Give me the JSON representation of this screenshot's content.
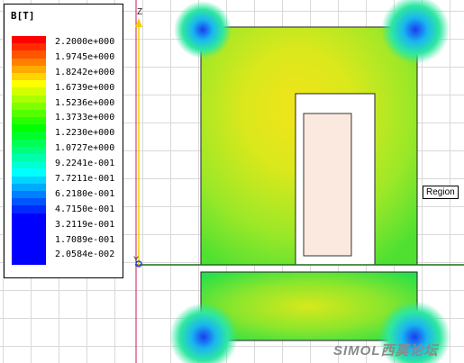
{
  "legend": {
    "title": "B[T]",
    "labels": [
      "2.2000e+000",
      "1.9745e+000",
      "1.8242e+000",
      "1.6739e+000",
      "1.5236e+000",
      "1.3733e+000",
      "1.2230e+000",
      "1.0727e+000",
      "9.2241e-001",
      "7.7211e-001",
      "6.2180e-001",
      "4.7150e-001",
      "3.2119e-001",
      "1.7089e-001",
      "2.0584e-002"
    ],
    "colors": [
      "#ff0000",
      "#ff2a00",
      "#ff5500",
      "#ff8000",
      "#ffaa00",
      "#ffd400",
      "#ffff00",
      "#d4ff00",
      "#aaff00",
      "#80ff00",
      "#55ff00",
      "#2aff00",
      "#00ff00",
      "#00ff2a",
      "#00ff55",
      "#00ff80",
      "#00ffaa",
      "#00ffd4",
      "#00ffff",
      "#00d4ff",
      "#00aaff",
      "#0080ff",
      "#0055ff",
      "#002aff",
      "#0000ff",
      "#0000ff",
      "#0000ff",
      "#0000ff",
      "#0000ff",
      "#0000ff",
      "#0000ff"
    ]
  },
  "axes": {
    "z_label": "Z",
    "y_label": "Y"
  },
  "tooltip": {
    "text": "Region"
  },
  "watermark": {
    "text": "SIMOL西莫论坛"
  }
}
